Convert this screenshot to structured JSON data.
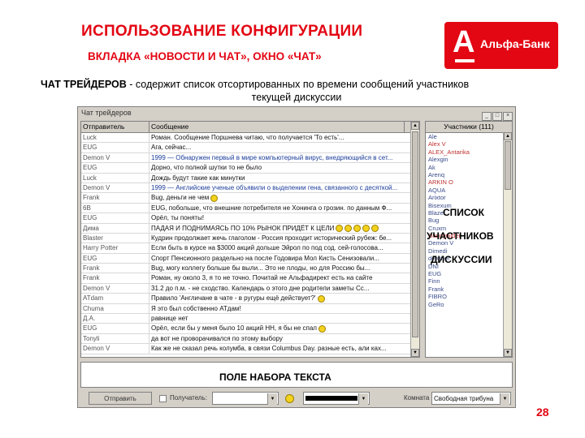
{
  "slide": {
    "title": "ИСПОЛЬЗОВАНИЕ КОНФИГУРАЦИИ",
    "subtitle": "ВКЛАДКА «НОВОСТИ И ЧАТ», ОКНО «ЧАТ»",
    "logo_letter": "А",
    "logo_name": "Альфа-Банк",
    "desc_bold": "ЧАТ ТРЕЙДЕРОВ",
    "desc_line1": " - содержит список отсортированных по времени сообщений участников",
    "desc_line2": "текущей дискуссии",
    "users_note_1": "СПИСОК",
    "users_note_2": "УЧАСТНИКОВ",
    "users_note_3": "ДИСКУССИИ",
    "input_note": "ПОЛЕ НАБОРА ТЕКСТА",
    "page_number": "28"
  },
  "window": {
    "title": "Чат трейдеров",
    "col_sender": "Отправитель",
    "col_message": "Сообщение",
    "users_header": "Участники (111)",
    "send_label": "Отправить",
    "recipient_label": "Получатель:",
    "channel_label": "Комната",
    "channel_value": "Свободная трибуна"
  },
  "messages": [
    {
      "sender": "Luck",
      "text": "Роман. Сообщение Поршнева читаю, что получается 'То есть'..."
    },
    {
      "sender": "EUG",
      "text": "Ага, сейчас..."
    },
    {
      "sender": "Demon V",
      "text": "1999 — Обнаружен первый в мире компьютерный вирус, внедряющийся в сет..."
    },
    {
      "sender": "EUG",
      "text": "Дорно, что полной шутки то не было"
    },
    {
      "sender": "Luck",
      "text": "Дождь будут такие как минутки"
    },
    {
      "sender": "Demon V",
      "text": "1999 — Английские ученые объявили о выделении гена, связанного с десяткой..."
    },
    {
      "sender": "Frank",
      "text": "Bug, деньги не чем"
    },
    {
      "sender": "6B",
      "text": "EUG, побольше, что внешние потребителя не Хонинга о грозин. по данным Ф..."
    },
    {
      "sender": "EUG",
      "text": "Орёл, ты поняты!"
    },
    {
      "sender": "Дима",
      "text": "ПАДАЯ И ПОДНИМАЯСЬ ПО 10% РЫНОК ПРИДЁТ К ЦЕЛИ"
    },
    {
      "sender": "Blaster",
      "text": "Кудрин продолжает жечь глаголом - Россия проходит исторический рубеж: бе..."
    },
    {
      "sender": "Harry Potter",
      "text": "Если быть в курсе на $3000 акций дольше Эйрол по под сод. сей-голосова..."
    },
    {
      "sender": "EUG",
      "text": "Спорт Пенсионного раздельно на после Годовира Мол Кисть Сенизовали..."
    },
    {
      "sender": "Frank",
      "text": "Bug, могу коллегу больше бы выли... Это не плоды, но для Россию бы..."
    },
    {
      "sender": "Frank",
      "text": "Роман, ну около 3, я то не точно. Почитай не Альфадирект есть на сайте"
    },
    {
      "sender": "Demon V",
      "text": "31.2 до п.м. - не сходство. Календарь о этого дне родители заметы Сс..."
    },
    {
      "sender": "ATdam",
      "text": "Правило 'Англичане в чате - в ругуры ещё действует?'"
    },
    {
      "sender": "Chuma",
      "text": "Я это был собственно АТдам!"
    },
    {
      "sender": "Д.А.",
      "text": "равнице нет"
    },
    {
      "sender": "EUG",
      "text": "Орёл, если бы у меня было 10 акций НН, я бы не спал"
    },
    {
      "sender": "Tonyli",
      "text": "да вот не проворачивался по этому выбору"
    },
    {
      "sender": "Demon V",
      "text": "Как же не сказал речь колумба, в связи Columbus Day. разные есть, али ках..."
    }
  ],
  "users": [
    {
      "name": "Ale"
    },
    {
      "name": "Alex V"
    },
    {
      "name": "ALEX_Antarika"
    },
    {
      "name": "Alexgin"
    },
    {
      "name": "Ak"
    },
    {
      "name": "Arenq"
    },
    {
      "name": "ARKIN O"
    },
    {
      "name": "AQUA"
    },
    {
      "name": "Arixtor"
    },
    {
      "name": "Bisexum"
    },
    {
      "name": "Blazer"
    },
    {
      "name": "Bug"
    },
    {
      "name": "Cruxm"
    },
    {
      "name": "Dannynilder"
    },
    {
      "name": "Demon V"
    },
    {
      "name": "Dimedi"
    },
    {
      "name": "dewther"
    },
    {
      "name": "DNI"
    },
    {
      "name": "EUG"
    },
    {
      "name": "Finn"
    },
    {
      "name": "Frank"
    },
    {
      "name": "FIBRO"
    },
    {
      "name": "GeRo"
    }
  ],
  "colors": {
    "accent": "#e30613",
    "window_gray": "#d4d0c8",
    "link_blue": "#1b3c9a"
  }
}
